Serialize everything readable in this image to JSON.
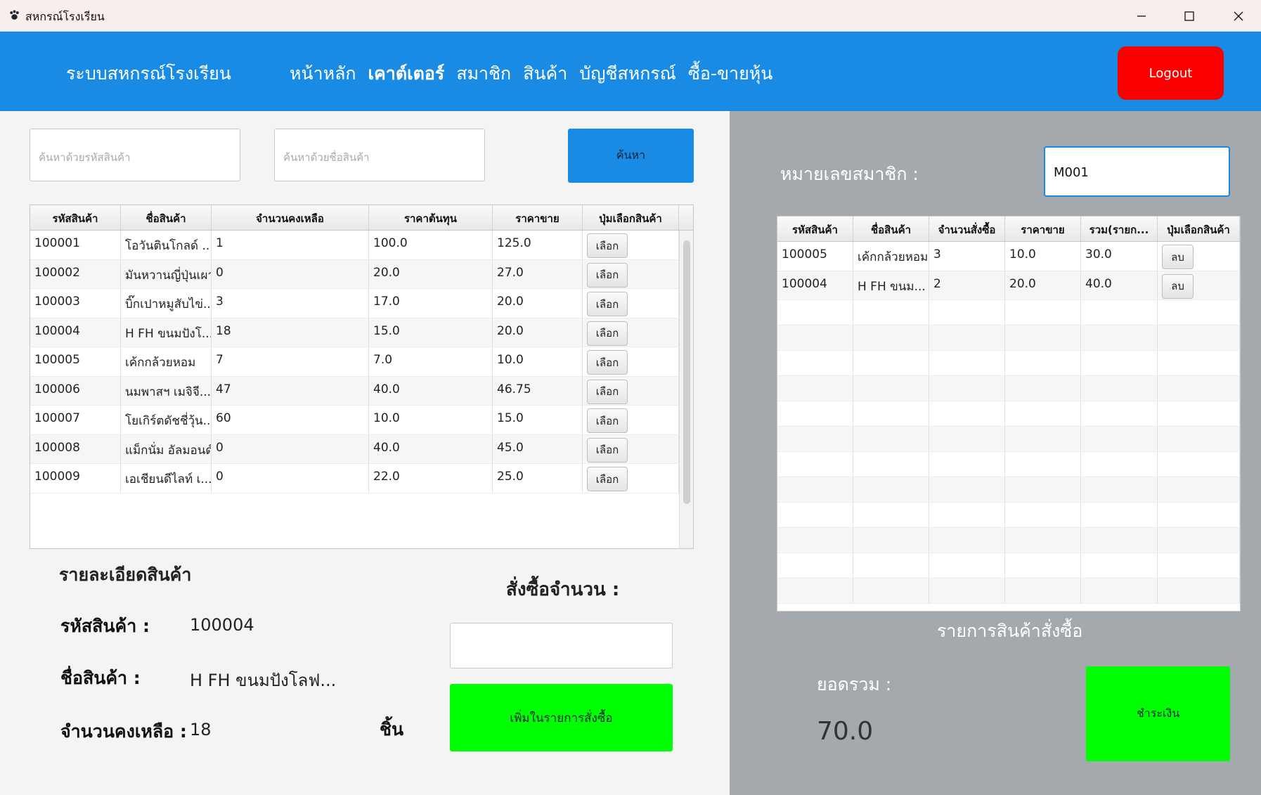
{
  "window": {
    "title": "สหกรณ์โรงเรียน",
    "icon": "paw-icon",
    "titlebar_color": "#f8eeee"
  },
  "header": {
    "brand": "ระบบสหกรณ์โรงเรียน",
    "nav": [
      "หน้าหลัก",
      "เคาต์เตอร์",
      "สมาชิก",
      "สินค้า",
      "บัญชีสหกรณ์",
      "ซื้อ-ขายหุ้น"
    ],
    "active_nav": "เคาต์เตอร์",
    "logout_label": "Logout",
    "color": "#1a8be4",
    "logout_color": "#fb0000"
  },
  "search": {
    "code_placeholder": "ค้นหาด้วยรหัสสินค้า",
    "name_placeholder": "ค้นหาด้วยชื่อสินค้า",
    "button_label": "ค้นหา"
  },
  "products": {
    "columns": [
      "รหัสสินค้า",
      "ชื่อสินค้า",
      "จำนวนคงเหลือ",
      "ราคาต้นทุน",
      "ราคาขาย",
      "ปุ่มเลือกสินค้า"
    ],
    "select_label": "เลือก",
    "rows": [
      [
        "100001",
        "โอวันตินโกลด์ ...",
        "1",
        "100.0",
        "125.0"
      ],
      [
        "100002",
        "มันหวานญี่ปุ่นเผา",
        "0",
        "20.0",
        "27.0"
      ],
      [
        "100003",
        "บิ๊กเปาหมูสับไข่...",
        "3",
        "17.0",
        "20.0"
      ],
      [
        "100004",
        "H FH ขนมปังโ...",
        "18",
        "15.0",
        "20.0"
      ],
      [
        "100005",
        "เค้กกล้วยหอม",
        "7",
        "7.0",
        "10.0"
      ],
      [
        "100006",
        "นมพาสฯ เมจิจี...",
        "47",
        "40.0",
        "46.75"
      ],
      [
        "100007",
        "โยเกิร์ตดัชชี่วุ้น...",
        "60",
        "10.0",
        "15.0"
      ],
      [
        "100008",
        "แม็กนั่ม อัลมอนด์",
        "0",
        "40.0",
        "45.0"
      ],
      [
        "100009",
        "เอเชียนดีไลท์ เ...",
        "0",
        "22.0",
        "25.0"
      ]
    ]
  },
  "detail": {
    "title": "รายละเอียดสินค้า",
    "code_label": "รหัสสินค้า :",
    "code_value": "100004",
    "name_label": "ชื่อสินค้า :",
    "name_value": "H FH ขนมปังโลฟ...",
    "stock_label": "จำนวนคงเหลือ :",
    "stock_value": "18",
    "unit": "ชิ้น"
  },
  "order_form": {
    "qty_label": "สั่งซื้อจำนวน :",
    "add_label": "เพิ่มในรายการสั่งซื้อ",
    "add_color": "#00ff00"
  },
  "member": {
    "label": "หมายเลขสมาชิก :",
    "value": "M001"
  },
  "order_table": {
    "columns": [
      "รหัสสินค้า",
      "ชื่อสินค้า",
      "จำนวนสั่งซื้อ",
      "ราคาขาย",
      "รวม(รายก...",
      "ปุ่มเลือกสินค้า"
    ],
    "delete_label": "ลบ",
    "rows": [
      [
        "100005",
        "เค้กกล้วยหอม",
        "3",
        "10.0",
        "30.0"
      ],
      [
        "100004",
        "H FH ขนม...",
        "2",
        "20.0",
        "40.0"
      ]
    ],
    "caption": "รายการสินค้าสั่งซื้อ"
  },
  "total": {
    "label": "ยอดรวม :",
    "value": "70.0",
    "pay_label": "ชำระเงิน",
    "panel_color": "#a4a9ad"
  }
}
